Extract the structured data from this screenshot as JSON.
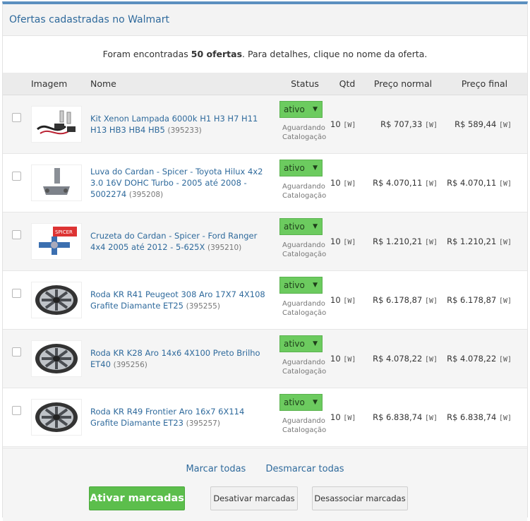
{
  "header": {
    "title": "Ofertas cadastradas no Walmart"
  },
  "summary": {
    "prefix": "Foram encontradas ",
    "count": "50 ofertas",
    "suffix": ". Para detalhes, clique no nome da oferta."
  },
  "table": {
    "columns": [
      "Imagem",
      "Nome",
      "Status",
      "Qtd",
      "Preço normal",
      "Preço final"
    ],
    "rows": [
      {
        "name": "Kit Xenon Lampada 6000k H1 H3 H7 H11 H13 HB3 HB4 HB5",
        "id": "(395233)",
        "status": "ativo",
        "status_sub": "Aguardando Catalogação",
        "qtd": "10",
        "qtd_w": "[W]",
        "preco_normal": "R$ 707,33",
        "pn_w": "[W]",
        "preco_final": "R$ 589,44",
        "pf_w": "[W]",
        "image": "xenon-kit-image"
      },
      {
        "name": "Luva do Cardan - Spicer - Toyota Hilux 4x2 3.0 16V DOHC Turbo - 2005 até 2008 - 5002274",
        "id": "(395208)",
        "status": "ativo",
        "status_sub": "Aguardando Catalogação",
        "qtd": "10",
        "qtd_w": "[W]",
        "preco_normal": "R$ 4.070,11",
        "pn_w": "[W]",
        "preco_final": "R$ 4.070,11",
        "pf_w": "[W]",
        "image": "cardan-sleeve-image"
      },
      {
        "name": "Cruzeta do Cardan - Spicer - Ford Ranger 4x4 2005 até 2012 - 5-625X",
        "id": "(395210)",
        "status": "ativo",
        "status_sub": "Aguardando Catalogação",
        "qtd": "10",
        "qtd_w": "[W]",
        "preco_normal": "R$ 1.210,21",
        "pn_w": "[W]",
        "preco_final": "R$ 1.210,21",
        "pf_w": "[W]",
        "image": "cardan-cross-image"
      },
      {
        "name": "Roda KR R41 Peugeot 308 Aro 17X7 4X108 Grafite Diamante ET25",
        "id": "(395255)",
        "status": "ativo",
        "status_sub": "Aguardando Catalogação",
        "qtd": "10",
        "qtd_w": "[W]",
        "preco_normal": "R$ 6.178,87",
        "pn_w": "[W]",
        "preco_final": "R$ 6.178,87",
        "pf_w": "[W]",
        "image": "wheel-image"
      },
      {
        "name": "Roda KR K28 Aro 14x6 4X100 Preto Brilho ET40",
        "id": "(395256)",
        "status": "ativo",
        "status_sub": "Aguardando Catalogação",
        "qtd": "10",
        "qtd_w": "[W]",
        "preco_normal": "R$ 4.078,22",
        "pn_w": "[W]",
        "preco_final": "R$ 4.078,22",
        "pf_w": "[W]",
        "image": "wheel-image"
      },
      {
        "name": "Roda KR R49 Frontier Aro 16x7 6X114 Grafite Diamante ET23",
        "id": "(395257)",
        "status": "ativo",
        "status_sub": "Aguardando Catalogação",
        "qtd": "10",
        "qtd_w": "[W]",
        "preco_normal": "R$ 6.838,74",
        "pn_w": "[W]",
        "preco_final": "R$ 6.838,74",
        "pf_w": "[W]",
        "image": "wheel-image"
      }
    ]
  },
  "footer": {
    "select_all": "Marcar todas",
    "deselect_all": "Desmarcar todas",
    "activate": "Ativar marcadas",
    "deactivate": "Desativar marcadas",
    "dissociate": "Desassociar marcadas"
  },
  "colors": {
    "accent": "#5b8fbf",
    "link": "#2f6a9c",
    "status_green": "#6ccb5f",
    "primary_button": "#5cbe4c"
  }
}
